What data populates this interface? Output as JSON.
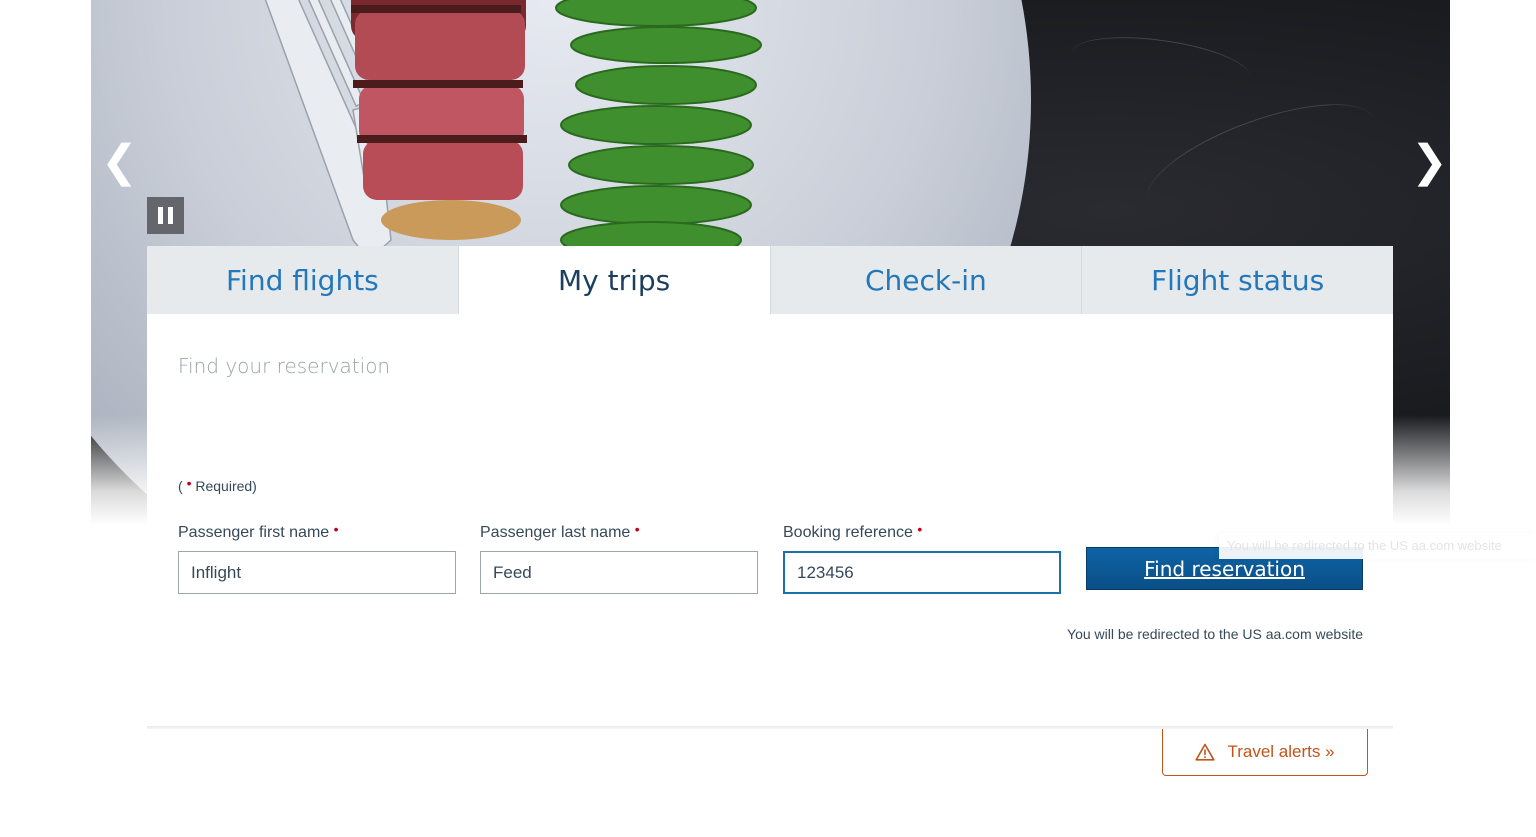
{
  "carousel": {
    "prev_glyph": "❮",
    "next_glyph": "❯",
    "pause_icon": "pause-icon"
  },
  "tabs": [
    {
      "label": "Find flights",
      "active": false
    },
    {
      "label": "My trips",
      "active": true
    },
    {
      "label": "Check-in",
      "active": false
    },
    {
      "label": "Flight status",
      "active": false
    }
  ],
  "reservation_form": {
    "title": "Find your reservation",
    "required_open": "(",
    "required_dot": "•",
    "required_text": "Required)",
    "fields": {
      "first_name": {
        "label": "Passenger first name",
        "value": "Inflight"
      },
      "last_name": {
        "label": "Passenger last name",
        "value": "Feed"
      },
      "booking_ref": {
        "label": "Booking reference",
        "value": "123456"
      }
    },
    "submit_label": "Find reservation",
    "redirect_note": "You will be redirected to the US aa.com website",
    "tooltip_text": "You will be redirected to the US aa.com website"
  },
  "travel_alerts": {
    "label": "Travel alerts »",
    "icon": "warning-icon"
  },
  "colors": {
    "tab_link": "#2477b8",
    "tab_active": "#1c3f5e",
    "button_blue": "#0a4f87",
    "required_red": "#c30019",
    "alert_orange": "#c2541a"
  }
}
